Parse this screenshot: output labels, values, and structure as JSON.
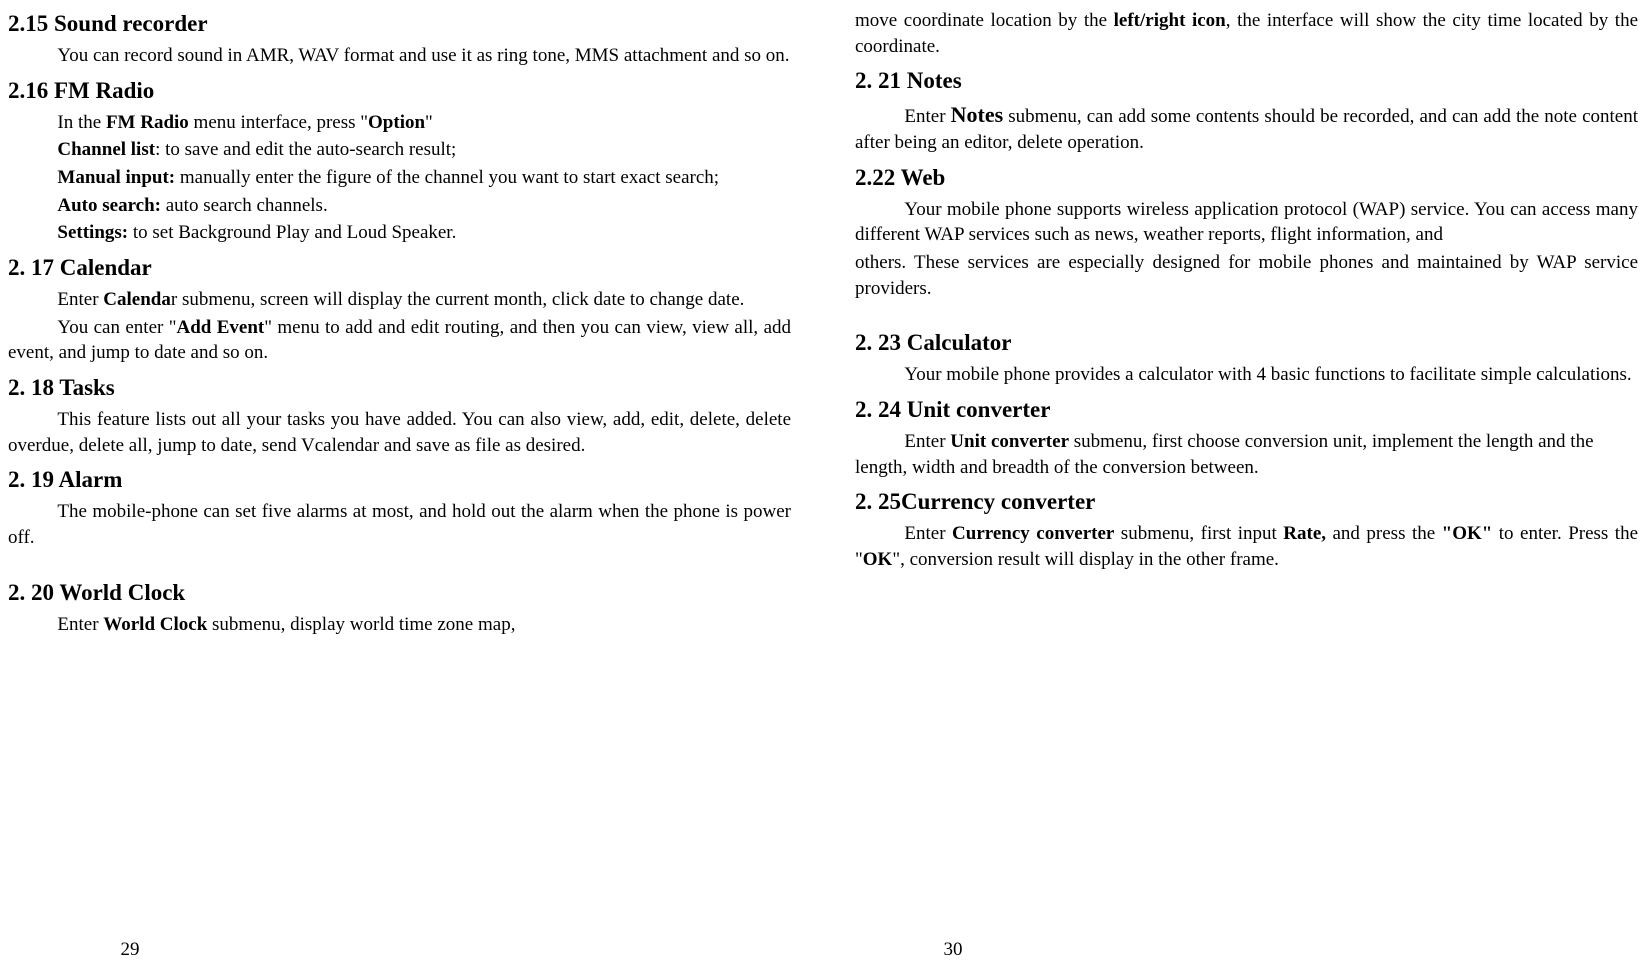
{
  "left": {
    "s215": {
      "title": "2.15 Sound recorder",
      "p1_a": "You can record sound in AMR, WAV format and use it as ring tone, MMS attachment and so on."
    },
    "s216": {
      "title": "2.16 FM Radio",
      "line1_a": " In the ",
      "line1_b": "FM Radio",
      "line1_c": " menu interface, press \"",
      "line1_d": "Option",
      "line1_e": "\"",
      "line2_a": "Channel list",
      "line2_b": ": to save and edit the auto-search result;",
      "line3_a": "Manual input:",
      "line3_b": " manually enter the figure of the channel you want to start exact search;",
      "line4_a": "Auto search:",
      "line4_b": " auto search channels.",
      "line5_a": "Settings:",
      "line5_b": " to set Background Play and Loud Speaker."
    },
    "s217": {
      "title": "2. 17 Calendar",
      "p1_a": "Enter ",
      "p1_b": "Calenda",
      "p1_c": "r submenu, screen will display the current month, click date to change date.",
      "p2_a": "You can enter \"",
      "p2_b": "Add Event",
      "p2_c": "\" menu to add and edit routing, and then you can view, view all, add event, and jump to date and so on."
    },
    "s218": {
      "title": "2. 18 Tasks",
      "p1": "This feature lists out all your tasks you have added. You can also view, add, edit, delete, delete overdue, delete all, jump to date, send Vcalendar and save as file as desired."
    },
    "s219": {
      "title": "2. 19 Alarm",
      "p1": "The mobile-phone can set five alarms at most, and hold out the alarm when the phone is power off."
    },
    "s220": {
      "title": "2. 20 World Clock",
      "p1_a": "Enter ",
      "p1_b": "World Clock",
      "p1_c": " submenu, display world time zone map,"
    },
    "pagenum": "29"
  },
  "right": {
    "cont": {
      "a": "move coordinate location by the ",
      "b": "left/right icon",
      "c": ", the interface will show the city time located by the coordinate."
    },
    "s221": {
      "title": "2. 21 Notes",
      "p1_a": "Enter ",
      "p1_b": "Notes",
      "p1_c": " submenu, can add some contents should be recorded, and can add the note content after being an editor, delete operation."
    },
    "s222": {
      "title": "2.22 Web",
      "p1": "Your mobile phone supports wireless application protocol (WAP) service. You can access many different WAP services such as news, weather reports, flight information, and",
      "p2": "others. These services are especially designed for mobile phones and maintained by WAP service providers."
    },
    "s223": {
      "title": "2. 23 Calculator",
      "p1": "Your mobile phone provides a calculator with 4 basic functions to facilitate simple calculations."
    },
    "s224": {
      "title": "2. 24 Unit converter",
      "p1_a": "Enter ",
      "p1_b": "Unit converter",
      "p1_c": " submenu, first choose conversion unit, implement the length and the length, width and breadth of the conversion between."
    },
    "s225": {
      "title": "2. 25Currency converter",
      "p1_a": "Enter ",
      "p1_b": "Currency converter",
      "p1_c": " submenu, first input ",
      "p1_d": "Rate,",
      "p1_e": " and press the ",
      "p1_f": "\"OK\"",
      "p1_g": " to enter. Press the \"",
      "p1_h": "OK",
      "p1_i": "\", conversion result will display in the other frame."
    },
    "pagenum": "30"
  }
}
